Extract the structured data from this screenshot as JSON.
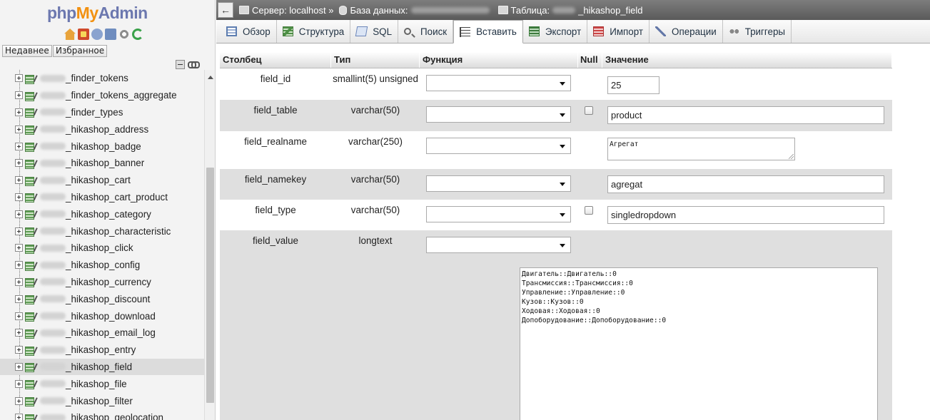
{
  "logo": {
    "php": "php",
    "my": "My",
    "admin": "Admin"
  },
  "left_icons": [
    "home-icon",
    "exit-icon",
    "info-icon",
    "docs-icon",
    "settings-gear-icon",
    "reload-icon"
  ],
  "left_buttons": {
    "recent": "Недавнее",
    "favorites": "Избранное"
  },
  "tree": {
    "items": [
      {
        "name": "_finder_tokens",
        "active": false
      },
      {
        "name": "_finder_tokens_aggregate",
        "active": false
      },
      {
        "name": "_finder_types",
        "active": false
      },
      {
        "name": "_hikashop_address",
        "active": false
      },
      {
        "name": "_hikashop_badge",
        "active": false
      },
      {
        "name": "_hikashop_banner",
        "active": false
      },
      {
        "name": "_hikashop_cart",
        "active": false
      },
      {
        "name": "_hikashop_cart_product",
        "active": false
      },
      {
        "name": "_hikashop_category",
        "active": false
      },
      {
        "name": "_hikashop_characteristic",
        "active": false
      },
      {
        "name": "_hikashop_click",
        "active": false
      },
      {
        "name": "_hikashop_config",
        "active": false
      },
      {
        "name": "_hikashop_currency",
        "active": false
      },
      {
        "name": "_hikashop_discount",
        "active": false
      },
      {
        "name": "_hikashop_download",
        "active": false
      },
      {
        "name": "_hikashop_email_log",
        "active": false
      },
      {
        "name": "_hikashop_entry",
        "active": false
      },
      {
        "name": "_hikashop_field",
        "active": true
      },
      {
        "name": "_hikashop_file",
        "active": false
      },
      {
        "name": "_hikashop_filter",
        "active": false
      },
      {
        "name": "_hikashop_geolocation",
        "active": false
      }
    ]
  },
  "breadcrumb": {
    "server_label": "Сервер: localhost »",
    "database_label": "База данных:",
    "table_label": "Таблица:",
    "table_name": "_hikashop_field"
  },
  "tabs": [
    {
      "label": "Обзор",
      "icon": "browse-icon",
      "active": false
    },
    {
      "label": "Структура",
      "icon": "structure-icon",
      "active": false
    },
    {
      "label": "SQL",
      "icon": "sql-icon",
      "active": false
    },
    {
      "label": "Поиск",
      "icon": "search-icon",
      "active": false
    },
    {
      "label": "Вставить",
      "icon": "insert-icon",
      "active": true
    },
    {
      "label": "Экспорт",
      "icon": "export-icon",
      "active": false
    },
    {
      "label": "Импорт",
      "icon": "import-icon",
      "active": false
    },
    {
      "label": "Операции",
      "icon": "operations-wrench-icon",
      "active": false
    },
    {
      "label": "Триггеры",
      "icon": "triggers-icon",
      "active": false
    }
  ],
  "grid": {
    "headers": {
      "column": "Столбец",
      "type": "Тип",
      "function": "Функция",
      "null": "Null",
      "value": "Значение"
    },
    "rows": [
      {
        "name": "field_id",
        "type": "smallint(5) unsigned",
        "value": "25",
        "has_null": false,
        "input": "short"
      },
      {
        "name": "field_table",
        "type": "varchar(50)",
        "value": "product",
        "has_null": true,
        "input": "text"
      },
      {
        "name": "field_realname",
        "type": "varchar(250)",
        "value": "Агрегат",
        "has_null": false,
        "input": "textarea"
      },
      {
        "name": "field_namekey",
        "type": "varchar(50)",
        "value": "agregat",
        "has_null": false,
        "input": "text"
      },
      {
        "name": "field_type",
        "type": "varchar(50)",
        "value": "singledropdown",
        "has_null": true,
        "input": "text"
      },
      {
        "name": "field_value",
        "type": "longtext",
        "value": "Двигатель::Двигатель::0\nТрансмиссия::Трансмиссия::0\nУправление::Управление::0\nКузов::Кузов::0\nХодовая::Ходовая::0\nДопоборудование::Допоборудование::0",
        "has_null": false,
        "input": "bigtextarea"
      }
    ]
  }
}
